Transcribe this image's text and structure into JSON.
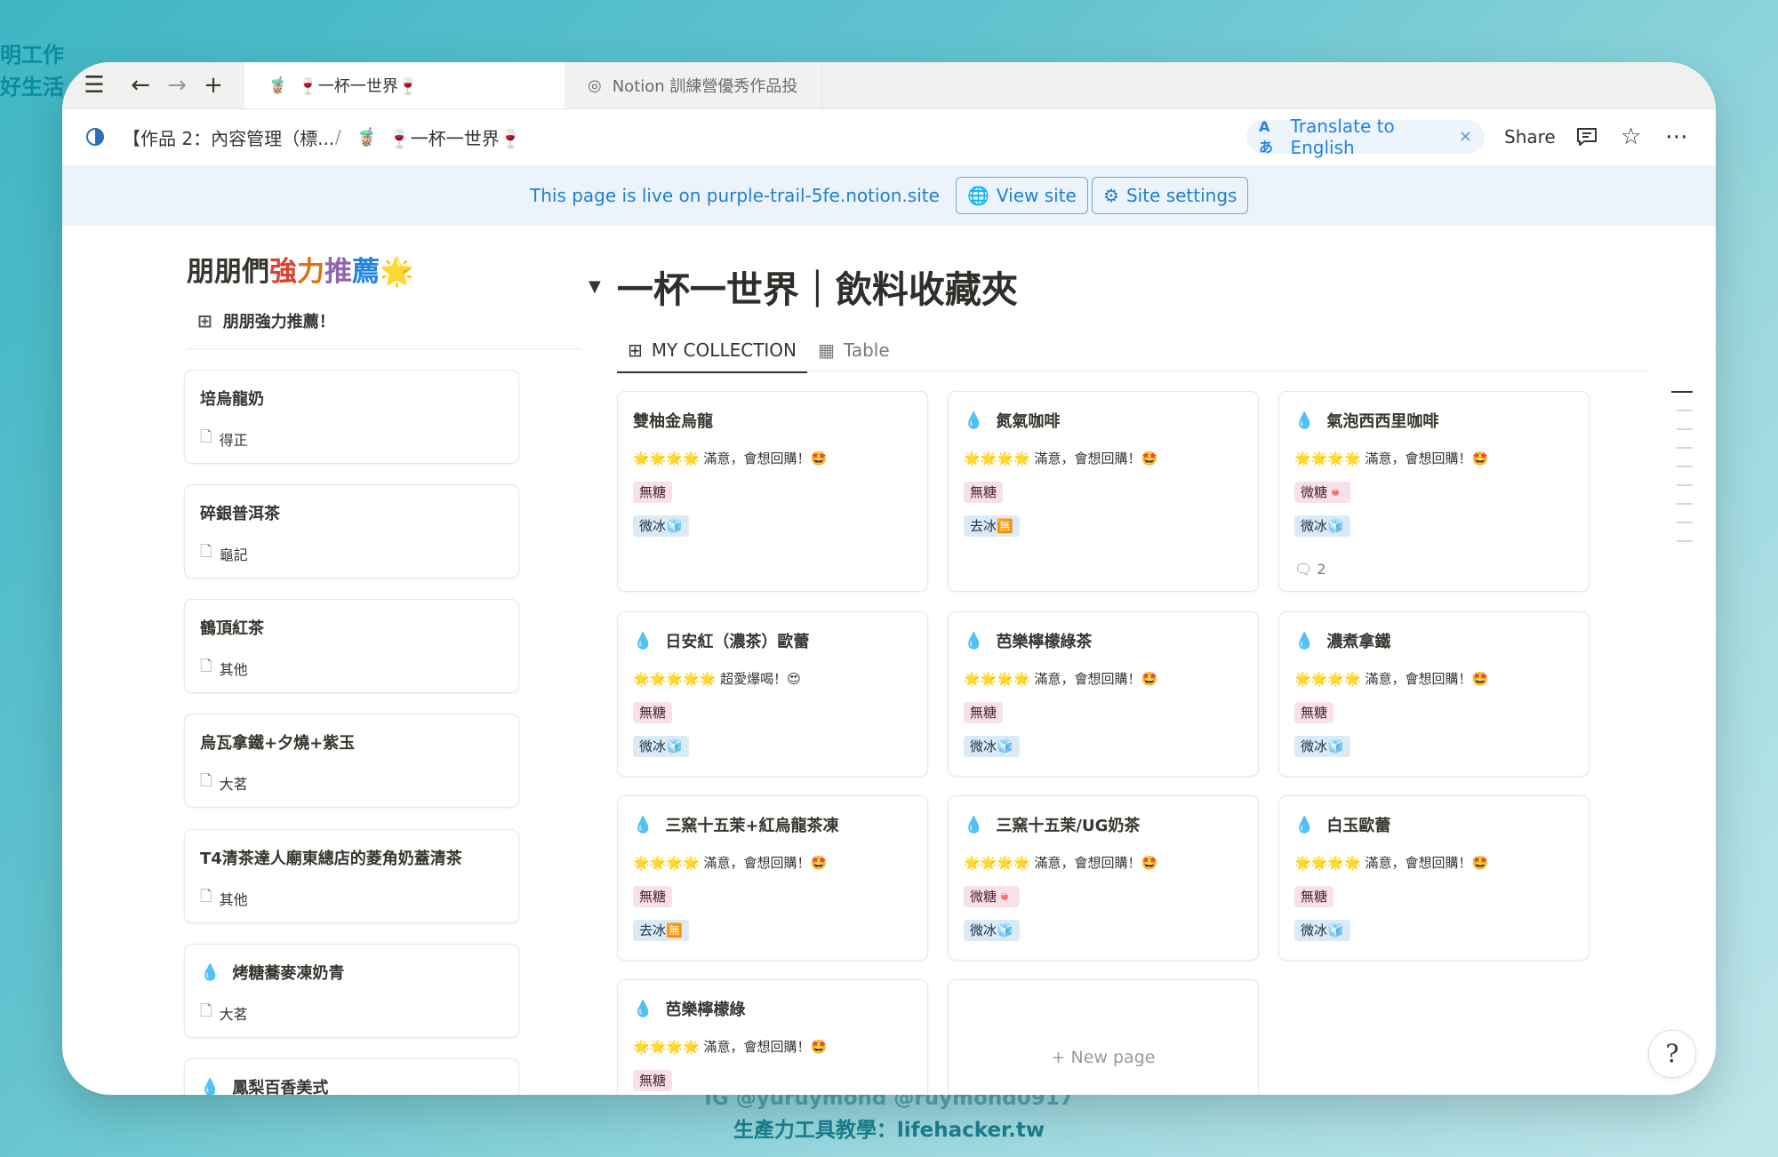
{
  "background": {
    "side_text": [
      "明工作",
      "好生活"
    ],
    "bottom_text": [
      "IG @yuruymond  @ruymond0917",
      "生產力工具教學：lifehacker.tw"
    ]
  },
  "tabs": [
    {
      "icon": "🧋",
      "label": "🍷一杯一世界🍷"
    },
    {
      "icon": "◎",
      "label": "Notion 訓練營優秀作品投"
    }
  ],
  "breadcrumb": {
    "workspace": "【作品 2：內容管理（標...",
    "separator": "/",
    "page_icon": "🧋",
    "page": "🍷一杯一世界🍷"
  },
  "topbar": {
    "translate_icon": "Aあ",
    "translate_label": "Translate to English",
    "share_label": "Share"
  },
  "banner": {
    "text": "This page is live on purple-trail-5fe.notion.site",
    "view_site": "View site",
    "site_settings": "Site settings"
  },
  "left": {
    "title_parts": [
      "朋朋們",
      "強",
      "力",
      "推",
      "薦",
      "🌟"
    ],
    "view_label": "朋朋強力推薦！",
    "items": [
      {
        "title": "培烏龍奶",
        "sub": "得正",
        "drop": false
      },
      {
        "title": "碎銀普洱茶",
        "sub": "龜記",
        "drop": false
      },
      {
        "title": "鶴頂紅茶",
        "sub": "其他",
        "drop": false
      },
      {
        "title": "烏瓦拿鐵+夕燒+紫玉",
        "sub": "大茗",
        "drop": false
      },
      {
        "title": "T4清茶達人廟東總店的菱角奶蓋清茶",
        "sub": "其他",
        "drop": false
      },
      {
        "title": "烤糖蕎麥凍奶青",
        "sub": "大茗",
        "drop": true
      },
      {
        "title": "鳳梨百香美式",
        "sub": "",
        "drop": true
      }
    ]
  },
  "main": {
    "title": "一杯一世界｜飲料收藏夾",
    "tabs": [
      {
        "label": "MY COLLECTION"
      },
      {
        "label": "Table"
      }
    ],
    "cards": [
      {
        "title": "雙柚金烏龍",
        "drop": false,
        "rating": "🌟🌟🌟🌟 滿意，會想回購！🤩",
        "sugar": "無糖",
        "ice": "微冰🧊",
        "comments": ""
      },
      {
        "title": "氮氣咖啡",
        "drop": true,
        "rating": "🌟🌟🌟🌟 滿意，會想回購！🤩",
        "sugar": "無糖",
        "ice": "去冰🈚",
        "comments": ""
      },
      {
        "title": "氣泡西西里咖啡",
        "drop": true,
        "rating": "🌟🌟🌟🌟 滿意，會想回購！🤩",
        "sugar": "微糖🍬",
        "ice": "微冰🧊",
        "comments": "2"
      },
      {
        "title": "日安紅（濃茶）歐蕾",
        "drop": true,
        "rating": "🌟🌟🌟🌟🌟 超愛爆喝！😍",
        "sugar": "無糖",
        "ice": "微冰🧊",
        "comments": ""
      },
      {
        "title": "芭樂檸檬綠茶",
        "drop": true,
        "rating": "🌟🌟🌟🌟 滿意，會想回購！🤩",
        "sugar": "無糖",
        "ice": "微冰🧊",
        "comments": ""
      },
      {
        "title": "濃煮拿鐵",
        "drop": true,
        "rating": "🌟🌟🌟🌟 滿意，會想回購！🤩",
        "sugar": "無糖",
        "ice": "微冰🧊",
        "comments": ""
      },
      {
        "title": "三窯十五茉+紅烏龍茶凍",
        "drop": true,
        "rating": "🌟🌟🌟🌟 滿意，會想回購！🤩",
        "sugar": "無糖",
        "ice": "去冰🈚",
        "comments": ""
      },
      {
        "title": "三窯十五茉/UG奶茶",
        "drop": true,
        "rating": "🌟🌟🌟🌟 滿意，會想回購！🤩",
        "sugar": "微糖🍬",
        "ice": "微冰🧊",
        "comments": ""
      },
      {
        "title": "白玉歐蕾",
        "drop": true,
        "rating": "🌟🌟🌟🌟 滿意，會想回購！🤩",
        "sugar": "無糖",
        "ice": "微冰🧊",
        "comments": ""
      },
      {
        "title": "芭樂檸檬綠",
        "drop": true,
        "rating": "🌟🌟🌟🌟 滿意，會想回購！🤩",
        "sugar": "無糖",
        "ice": "",
        "comments": ""
      }
    ],
    "new_page": "New page"
  }
}
